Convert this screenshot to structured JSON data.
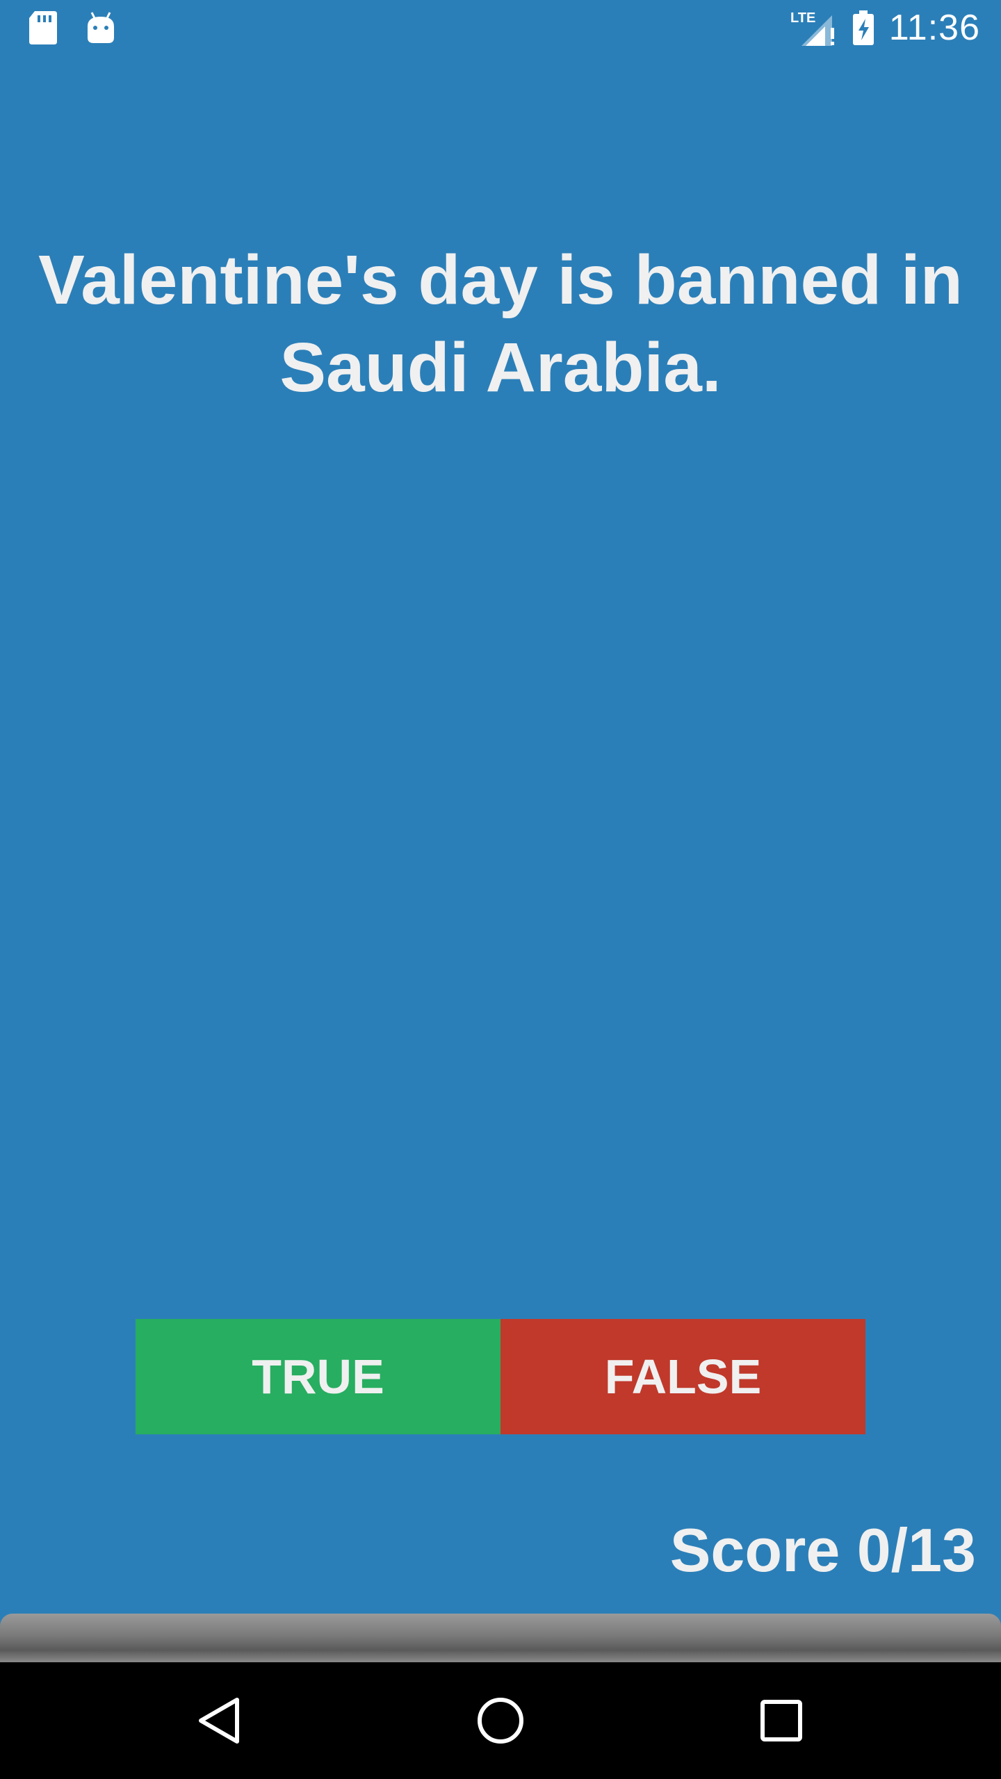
{
  "status_bar": {
    "time": "11:36",
    "network_label": "LTE",
    "icons": [
      "sd-card-icon",
      "android-icon",
      "lte-signal-icon",
      "battery-charging-icon"
    ]
  },
  "quiz": {
    "question": "Valentine's day is banned in Saudi Arabia.",
    "true_label": "TRUE",
    "false_label": "FALSE",
    "score_label": "Score 0/13",
    "progress_fraction": 0
  },
  "colors": {
    "background": "#2b7fb8",
    "true_button": "#27ae60",
    "false_button": "#c0392b",
    "text": "#f0f0f0"
  },
  "navigation": {
    "icons": [
      "back-icon",
      "home-icon",
      "recents-icon"
    ]
  }
}
